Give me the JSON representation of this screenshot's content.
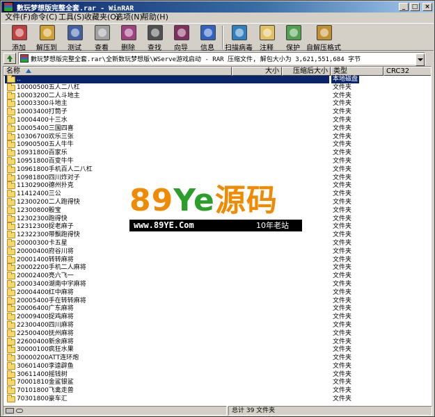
{
  "window": {
    "title": "數玩梦想版完整全套.rar - WinRAR",
    "minimize_glyph": "_",
    "maximize_glyph": "□",
    "close_glyph": "×"
  },
  "menu": [
    "文件(F)",
    "命令(C)",
    "工具(S)",
    "收藏夹(O)",
    "选项(N)",
    "帮助(H)"
  ],
  "toolbar": [
    {
      "label": "添加",
      "icon": "add-archive-icon",
      "color": "#c04040"
    },
    {
      "label": "解压到",
      "icon": "extract-to-icon",
      "color": "#d0a030"
    },
    {
      "label": "测试",
      "icon": "test-icon",
      "color": "#4060a0"
    },
    {
      "label": "查看",
      "icon": "view-icon",
      "color": "#a0a0a0"
    },
    {
      "label": "删除",
      "icon": "delete-icon",
      "color": "#a04080"
    },
    {
      "label": "查找",
      "icon": "find-icon",
      "color": "#505050"
    },
    {
      "label": "向导",
      "icon": "wizard-icon",
      "color": "#803060"
    },
    {
      "label": "信息",
      "icon": "info-icon",
      "color": "#3060c0"
    },
    {
      "label": "扫描病毒",
      "icon": "virus-scan-icon",
      "color": "#3080c0"
    },
    {
      "label": "注释",
      "icon": "comment-icon",
      "color": "#e0c060"
    },
    {
      "label": "保护",
      "icon": "protect-icon",
      "color": "#50a050"
    },
    {
      "label": "自解压格式",
      "icon": "sfx-icon",
      "color": "#c09030"
    }
  ],
  "address": {
    "path": "數玩梦想版完整全套.rar\\全新数玩梦想版\\WServe游戏启动 - RAR 压缩文件, 解包大小为 3,621,551,684 字节"
  },
  "columns": {
    "name": "名称",
    "size": "大小",
    "packed": "压缩后大小",
    "type": "类型",
    "crc": "CRC32"
  },
  "rows": [
    {
      "name": "..",
      "type": "本地磁盘",
      "selected": true
    },
    {
      "name": "10000500五人二八杠",
      "type": "文件夹"
    },
    {
      "name": "10003200二人斗地主",
      "type": "文件夹"
    },
    {
      "name": "10003300斗地主",
      "type": "文件夹"
    },
    {
      "name": "10003400打筒子",
      "type": "文件夹"
    },
    {
      "name": "10004400十三水",
      "type": "文件夹"
    },
    {
      "name": "10005400三国四喜",
      "type": "文件夹"
    },
    {
      "name": "10306700欢乐三张",
      "type": "文件夹"
    },
    {
      "name": "10900500五人牛牛",
      "type": "文件夹"
    },
    {
      "name": "10931800百家乐",
      "type": "文件夹"
    },
    {
      "name": "10951800百变牛牛",
      "type": "文件夹"
    },
    {
      "name": "10961800手机百人二八杠",
      "type": "文件夹"
    },
    {
      "name": "10981800四川炸对子",
      "type": "文件夹"
    },
    {
      "name": "11302900德州扑克",
      "type": "文件夹"
    },
    {
      "name": "11412400三公",
      "type": "文件夹"
    },
    {
      "name": "12300200二人跑得快",
      "type": "文件夹"
    },
    {
      "name": "12300800骰宝",
      "type": "文件夹"
    },
    {
      "name": "12302300跑得快",
      "type": "文件夹"
    },
    {
      "name": "12312300捉老麻子",
      "type": "文件夹"
    },
    {
      "name": "12322300带飘跑得快",
      "type": "文件夹"
    },
    {
      "name": "20000300卡五星",
      "type": "文件夹"
    },
    {
      "name": "20000400府谷川将",
      "type": "文件夹"
    },
    {
      "name": "20001400转转麻将",
      "type": "文件夹"
    },
    {
      "name": "20002200手机二人麻将",
      "type": "文件夹"
    },
    {
      "name": "20002400亮六飞一",
      "type": "文件夹"
    },
    {
      "name": "20003400湖南中宇麻将",
      "type": "文件夹"
    },
    {
      "name": "20004400红中麻将",
      "type": "文件夹"
    },
    {
      "name": "20005400手在转转麻将",
      "type": "文件夹"
    },
    {
      "name": "20006400广东麻将",
      "type": "文件夹"
    },
    {
      "name": "20009400捉鸡麻将",
      "type": "文件夹"
    },
    {
      "name": "22300400四川麻将",
      "type": "文件夹"
    },
    {
      "name": "22500400抚州麻将",
      "type": "文件夹"
    },
    {
      "name": "22600400新余麻将",
      "type": "文件夹"
    },
    {
      "name": "30000100疯狂水果",
      "type": "文件夹"
    },
    {
      "name": "30000200ATT连环炮",
      "type": "文件夹"
    },
    {
      "name": "30601400李逵辟鱼",
      "type": "文件夹"
    },
    {
      "name": "30611400摇钱树",
      "type": "文件夹"
    },
    {
      "name": "70001810金鲨银鲨",
      "type": "文件夹"
    },
    {
      "name": "70101800飞禽走兽",
      "type": "文件夹"
    },
    {
      "name": "70301800豪车汇",
      "type": "文件夹"
    }
  ],
  "status": {
    "total": "总计 39 文件夹"
  },
  "watermark": {
    "brand_prefix": "89",
    "brand_ye": "Ye",
    "brand_suffix": "源码",
    "url": "www.89YE.Com",
    "tagline": "10年老站"
  }
}
